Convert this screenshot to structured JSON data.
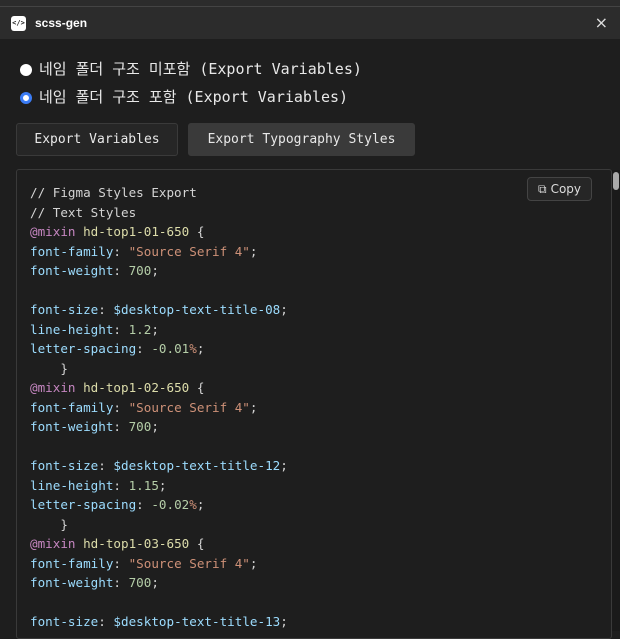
{
  "window": {
    "title": "scss-gen",
    "icon": "code-icon",
    "close": "×"
  },
  "options": [
    {
      "label": "네임 폴더 구조 미포함 (Export Variables)",
      "selected": false
    },
    {
      "label": "네임 폴더 구조 포함 (Export Variables)",
      "selected": true
    }
  ],
  "buttons": {
    "export_variables": "Export Variables",
    "export_typography": "Export Typography Styles"
  },
  "copy_label": "Copy",
  "code_lines": [
    [
      [
        "c",
        "// Figma Styles Export"
      ]
    ],
    [
      [
        "c",
        "// Text Styles"
      ]
    ],
    [
      [
        "k",
        "@mixin"
      ],
      [
        "t",
        " "
      ],
      [
        "s",
        "hd-top1-01-650"
      ],
      [
        "t",
        " {"
      ]
    ],
    [
      [
        "p",
        "font-family"
      ],
      [
        "t",
        ": "
      ],
      [
        "str",
        "\"Source Serif 4\""
      ],
      [
        "t",
        ";"
      ]
    ],
    [
      [
        "p",
        "font-weight"
      ],
      [
        "t",
        ": "
      ],
      [
        "n",
        "700"
      ],
      [
        "t",
        ";"
      ]
    ],
    [],
    [
      [
        "p",
        "font-size"
      ],
      [
        "t",
        ": "
      ],
      [
        "p",
        "$desktop-text-title-08"
      ],
      [
        "t",
        ";"
      ]
    ],
    [
      [
        "p",
        "line-height"
      ],
      [
        "t",
        ": "
      ],
      [
        "n",
        "1.2"
      ],
      [
        "t",
        ";"
      ]
    ],
    [
      [
        "p",
        "letter-spacing"
      ],
      [
        "t",
        ": "
      ],
      [
        "n",
        "-0.01"
      ],
      [
        "str",
        "%"
      ],
      [
        "t",
        ";"
      ]
    ],
    [
      [
        "t",
        "    }"
      ]
    ],
    [
      [
        "k",
        "@mixin"
      ],
      [
        "t",
        " "
      ],
      [
        "s",
        "hd-top1-02-650"
      ],
      [
        "t",
        " {"
      ]
    ],
    [
      [
        "p",
        "font-family"
      ],
      [
        "t",
        ": "
      ],
      [
        "str",
        "\"Source Serif 4\""
      ],
      [
        "t",
        ";"
      ]
    ],
    [
      [
        "p",
        "font-weight"
      ],
      [
        "t",
        ": "
      ],
      [
        "n",
        "700"
      ],
      [
        "t",
        ";"
      ]
    ],
    [],
    [
      [
        "p",
        "font-size"
      ],
      [
        "t",
        ": "
      ],
      [
        "p",
        "$desktop-text-title-12"
      ],
      [
        "t",
        ";"
      ]
    ],
    [
      [
        "p",
        "line-height"
      ],
      [
        "t",
        ": "
      ],
      [
        "n",
        "1.15"
      ],
      [
        "t",
        ";"
      ]
    ],
    [
      [
        "p",
        "letter-spacing"
      ],
      [
        "t",
        ": "
      ],
      [
        "n",
        "-0.02"
      ],
      [
        "str",
        "%"
      ],
      [
        "t",
        ";"
      ]
    ],
    [
      [
        "t",
        "    }"
      ]
    ],
    [
      [
        "k",
        "@mixin"
      ],
      [
        "t",
        " "
      ],
      [
        "s",
        "hd-top1-03-650"
      ],
      [
        "t",
        " {"
      ]
    ],
    [
      [
        "p",
        "font-family"
      ],
      [
        "t",
        ": "
      ],
      [
        "str",
        "\"Source Serif 4\""
      ],
      [
        "t",
        ";"
      ]
    ],
    [
      [
        "p",
        "font-weight"
      ],
      [
        "t",
        ": "
      ],
      [
        "n",
        "700"
      ],
      [
        "t",
        ";"
      ]
    ],
    [],
    [
      [
        "p",
        "font-size"
      ],
      [
        "t",
        ": "
      ],
      [
        "p",
        "$desktop-text-title-13"
      ],
      [
        "t",
        ";"
      ]
    ]
  ]
}
